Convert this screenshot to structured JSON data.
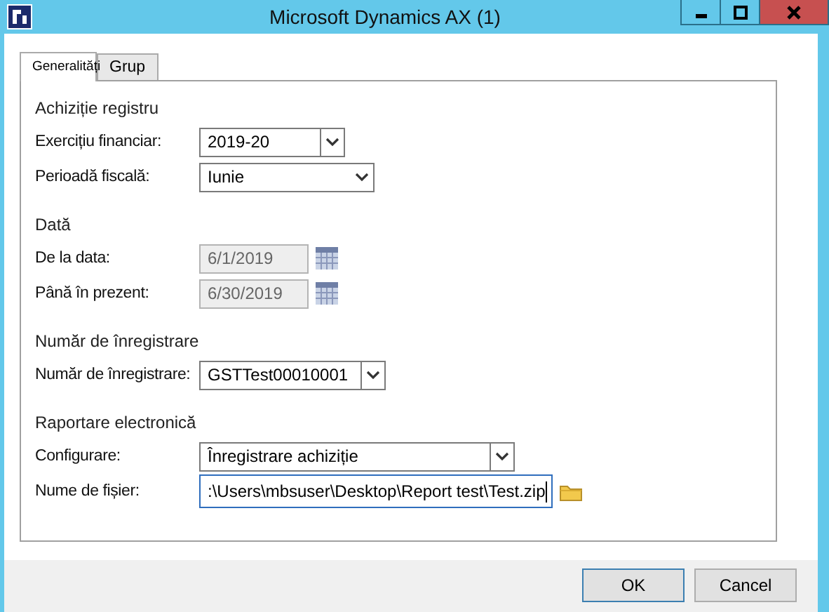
{
  "window": {
    "title": "Microsoft Dynamics AX (1)"
  },
  "tabs": [
    {
      "label": "Generalități",
      "selected": true
    },
    {
      "label": "Grup",
      "selected": false
    }
  ],
  "sections": [
    {
      "title": "Achiziție registru",
      "fields": [
        {
          "label": "Exercițiu financiar:",
          "kind": "combo",
          "value": "2019-20",
          "disabled": false,
          "focused": false
        },
        {
          "label": "Perioadă fiscală:",
          "kind": "dropdown",
          "value": "Iunie",
          "disabled": false,
          "focused": false
        }
      ]
    },
    {
      "title": "Dată",
      "fields": [
        {
          "label": "De la data:",
          "kind": "date",
          "value": "6/1/2019",
          "disabled": true,
          "focused": false
        },
        {
          "label": "Până în prezent:",
          "kind": "date",
          "value": "6/30/2019",
          "disabled": true,
          "focused": false
        }
      ]
    },
    {
      "title": "Număr de înregistrare",
      "fields": [
        {
          "label": "Număr de înregistrare:",
          "kind": "combo",
          "value": "GSTTest00010001",
          "disabled": false,
          "focused": false
        }
      ]
    },
    {
      "title": "Raportare electronică",
      "fields": [
        {
          "label": "Configurare:",
          "kind": "combo",
          "value": "Înregistrare achiziție",
          "disabled": false,
          "focused": false
        },
        {
          "label": "Nume de fișier:",
          "kind": "file",
          "value": ":\\Users\\mbsuser\\Desktop\\Report test\\Test.zip",
          "disabled": false,
          "focused": true
        }
      ]
    }
  ],
  "buttons": [
    "OK",
    "Cancel"
  ]
}
